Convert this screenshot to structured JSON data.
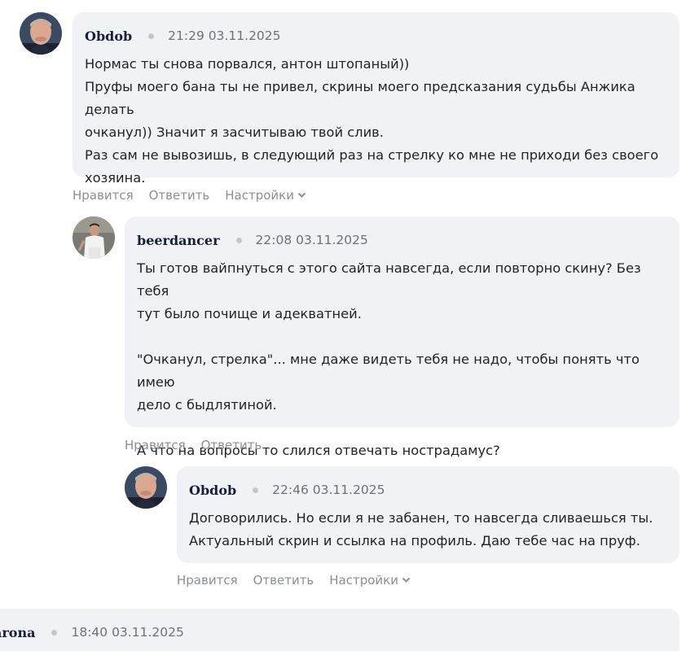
{
  "comments": [
    {
      "author": "Obdob",
      "datetime": "21:29 03.11.2025",
      "lines": [
        "Нормас ты снова порвался, антон штопаный))",
        "Пруфы моего бана ты не привел, скрины моего предсказания судьбы Анжика делать",
        "очканул)) Значит я засчитываю твой слив.",
        "Раз сам не вывозишь, в следующий раз на стрелку ко мне не приходи без своего",
        "хозяина."
      ],
      "like_label": "Нравится",
      "reply_label": "Ответить",
      "settings_label": "Настройки"
    },
    {
      "author": "beerdancer",
      "datetime": "22:08 03.11.2025",
      "lines": [
        "Ты готов вайпнуться с этого сайта навсегда, если повторно скину? Без тебя",
        "тут было почище и адекватней.",
        "",
        "\"Очканул, стрелка\"... мне даже видеть тебя не надо, чтобы понять что имею",
        "дело с быдлятиной.",
        "",
        "А что на вопросы то слился отвечать нострадамус?"
      ],
      "like_label": "Нравится",
      "reply_label": "Ответить"
    },
    {
      "author": "Obdob",
      "datetime": "22:46 03.11.2025",
      "lines": [
        "Договорились. Но если я не забанен, то навсегда сливаешься ты.",
        "Актуальный скрин и ссылка на профиль. Даю тебе час на пруф."
      ],
      "like_label": "Нравится",
      "reply_label": "Ответить",
      "settings_label": "Настройки"
    },
    {
      "author": "arona",
      "datetime": "18:40 03.11.2025"
    }
  ]
}
